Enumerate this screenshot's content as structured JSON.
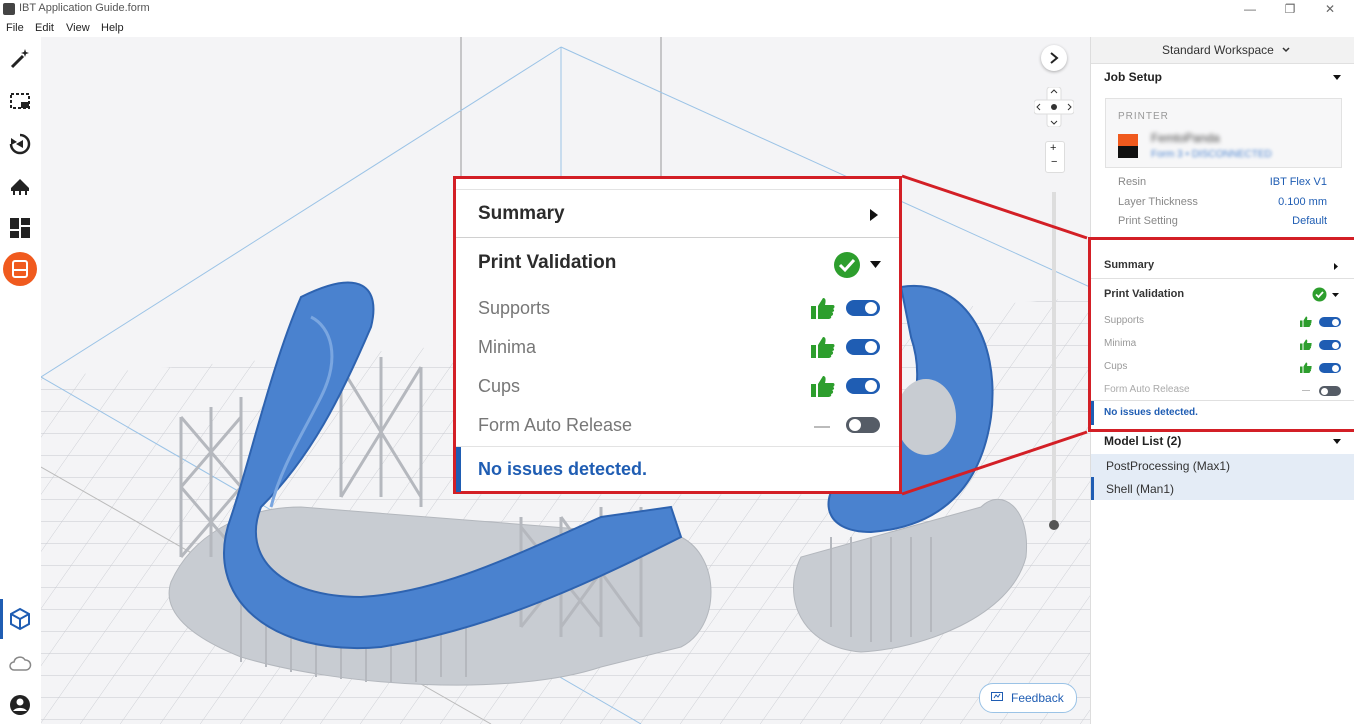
{
  "window": {
    "title": "IBT Application Guide.form",
    "minimize": "—",
    "restore": "❐",
    "close": "✕"
  },
  "menu": [
    {
      "label": "File"
    },
    {
      "label": "Edit"
    },
    {
      "label": "View"
    },
    {
      "label": "Help"
    }
  ],
  "left_tools": [
    {
      "name": "magic-wand-icon"
    },
    {
      "name": "selection-icon"
    },
    {
      "name": "orient-icon"
    },
    {
      "name": "supports-icon"
    },
    {
      "name": "layout-icon"
    },
    {
      "name": "print-icon"
    }
  ],
  "left_bottom": [
    {
      "name": "model-view-icon"
    },
    {
      "name": "cloud-icon"
    },
    {
      "name": "account-icon"
    }
  ],
  "viewport": {
    "feedback_label": "Feedback"
  },
  "right_panel": {
    "workspace_label": "Standard Workspace",
    "job_setup_title": "Job Setup",
    "printer_heading": "PRINTER",
    "printer_name": "FemtoPanda",
    "printer_status": "Form 3 • DISCONNECTED",
    "settings": [
      {
        "label": "Resin",
        "value": "IBT Flex V1"
      },
      {
        "label": "Layer Thickness",
        "value": "0.100 mm"
      },
      {
        "label": "Print Setting",
        "value": "Default"
      }
    ],
    "summary_label": "Summary",
    "validation_label": "Print Validation",
    "checks": [
      {
        "label": "Supports",
        "status": "pass",
        "enabled": true
      },
      {
        "label": "Minima",
        "status": "pass",
        "enabled": true
      },
      {
        "label": "Cups",
        "status": "pass",
        "enabled": true
      },
      {
        "label": "Form Auto Release",
        "status": "none",
        "enabled": false
      }
    ],
    "no_issues": "No issues detected.",
    "model_list_title": "Model List (2)",
    "models": [
      {
        "label": "PostProcessing (Max1)"
      },
      {
        "label": "Shell (Man1)"
      }
    ]
  },
  "callout": {
    "summary_label": "Summary",
    "validation_label": "Print Validation",
    "checks": [
      {
        "label": "Supports",
        "status": "pass",
        "enabled": true
      },
      {
        "label": "Minima",
        "status": "pass",
        "enabled": true
      },
      {
        "label": "Cups",
        "status": "pass",
        "enabled": true
      },
      {
        "label": "Form Auto Release",
        "status": "none",
        "enabled": false
      }
    ],
    "no_issues": "No issues detected."
  },
  "colors": {
    "accent": "#1f5db3",
    "toggle_on": "#1f5db3",
    "toggle_off": "#555c66",
    "pass_green": "#2d9e2d",
    "highlight": "#d31f26",
    "print_orange": "#f05a1e"
  }
}
